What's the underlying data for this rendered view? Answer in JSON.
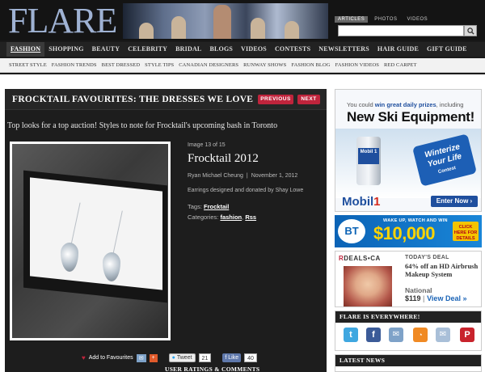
{
  "header": {
    "logo": "FLARE",
    "search_tabs": [
      "ARTICLES",
      "PHOTOS",
      "VIDEOS"
    ],
    "search_placeholder": ""
  },
  "nav_primary": [
    "FASHION",
    "SHOPPING",
    "BEAUTY",
    "CELEBRITY",
    "BRIDAL",
    "BLOGS",
    "VIDEOS",
    "CONTESTS",
    "NEWSLETTERS",
    "HAIR GUIDE",
    "GIFT GUIDE"
  ],
  "nav_secondary": [
    "STREET STYLE",
    "FASHION TRENDS",
    "BEST DRESSED",
    "STYLE TIPS",
    "CANADIAN DESIGNERS",
    "RUNWAY SHOWS",
    "FASHION BLOG",
    "FASHION VIDEOS",
    "RED CARPET"
  ],
  "article": {
    "title": "FROCKTAIL FAVOURITES: THE DRESSES WE LOVE",
    "previous": "PREVIOUS",
    "next": "NEXT",
    "subtitle": "Top looks for a top auction! Styles to note for Frocktail's upcoming bash in Toronto",
    "image_count": "Image 13 of 15",
    "photo_title": "Frocktail 2012",
    "author": "Ryan Michael Cheung",
    "separator": "|",
    "date": "November 1, 2012",
    "caption": "Earrings designed and donated by Shay Lowe",
    "tags_label": "Tags:",
    "tags": [
      "Frocktail"
    ],
    "categories_label": "Categories:",
    "categories": [
      "fashion",
      "Rss"
    ],
    "comma": ",",
    "add_favourites": "Add to Favourites",
    "tweet_label": "Tweet",
    "tweet_count": "21",
    "like_label": "Like",
    "like_count": "40",
    "ratings_heading": "USER RATINGS & COMMENTS"
  },
  "ad_mobil": {
    "line1_prefix": "You could",
    "line1_bold": "win great daily prizes",
    "line1_suffix": ", including",
    "line2": "New Ski Equipment!",
    "badge_line1": "Winterize",
    "badge_line2": "Your Life",
    "badge_line3": "Contest",
    "bottle_label": "Mobil 1",
    "brand": "Mobil",
    "brand_mark": "1",
    "cta": "Enter Now ›"
  },
  "ad_bt": {
    "logo": "BT",
    "tagline": "WAKE UP, WATCH AND WIN",
    "amount": "$10,000",
    "cta": "CLICK HERE FOR DETAILS"
  },
  "ad_rdeals": {
    "brand_r": "R",
    "brand_rest": "DEALS•CA",
    "deal_label": "TODAY'S DEAL",
    "offer": "64% off an HD Airbrush Makeup System",
    "location": "National",
    "price": "$119",
    "view": "View Deal »"
  },
  "everywhere": {
    "heading": "FLARE IS EVERYWHERE!",
    "icons": [
      "twitter-icon",
      "facebook-icon",
      "email-icon",
      "rss-icon",
      "mail-icon",
      "pinterest-icon"
    ]
  },
  "latest": {
    "heading": "LATEST NEWS"
  },
  "colors": {
    "accent_red": "#c0243c",
    "logo_blue": "#9fb2d3",
    "mobil_blue": "#1f4f9e"
  }
}
